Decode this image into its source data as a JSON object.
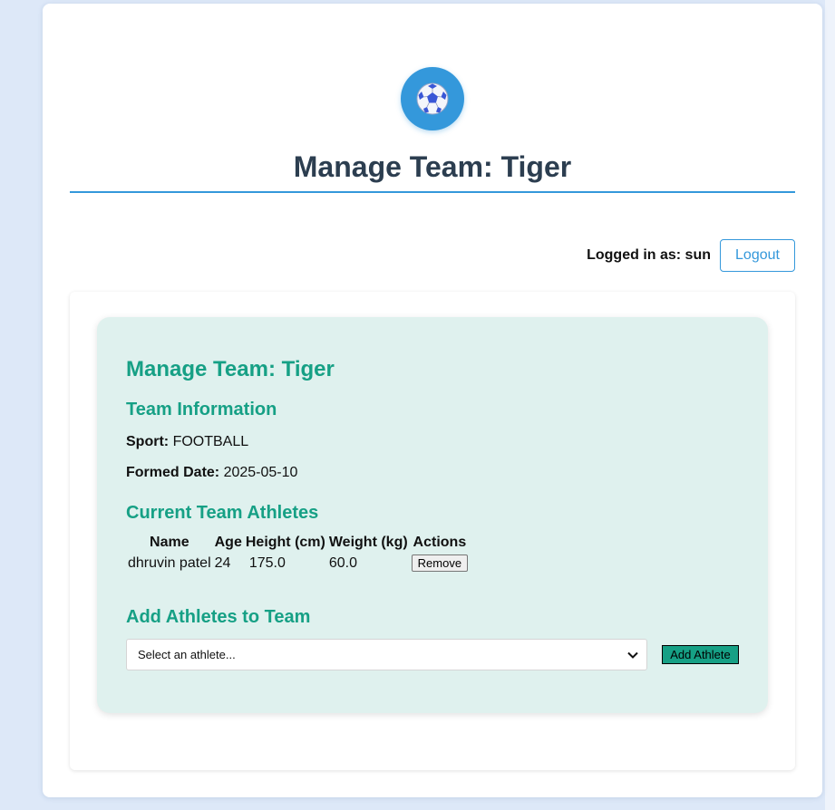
{
  "header": {
    "logo_icon": "soccer-ball-icon",
    "title": "Manage Team: Tiger",
    "accent_color": "#3498db"
  },
  "user": {
    "label": "Logged in as: sun",
    "logout_label": "Logout"
  },
  "team_card": {
    "title": "Manage Team: Tiger",
    "info_heading": "Team Information",
    "sport_key": "Sport:",
    "sport_value": "FOOTBALL",
    "formed_key": "Formed Date:",
    "formed_value": "2025-05-10",
    "athletes_heading": "Current Team Athletes",
    "columns": [
      "Name",
      "Age",
      "Height (cm)",
      "Weight (kg)",
      "Actions"
    ],
    "rows": [
      {
        "name": "dhruvin patel",
        "age": "24",
        "height": "175.0",
        "weight": "60.0",
        "action": "Remove"
      }
    ],
    "add_heading": "Add Athletes to Team",
    "select_value": "Select an athlete...",
    "add_button": "Add Athlete",
    "accent_color": "#16a085"
  }
}
